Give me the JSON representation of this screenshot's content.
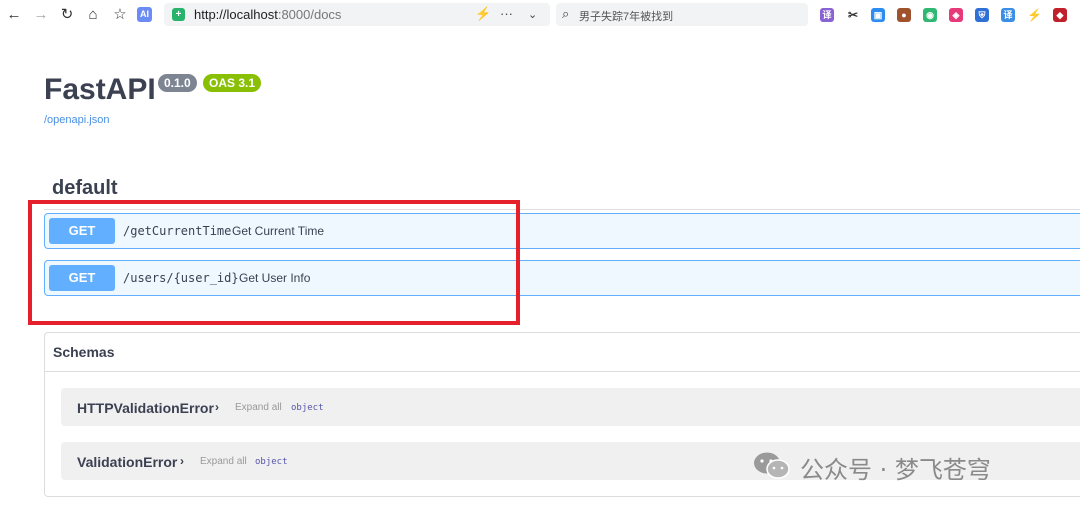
{
  "browser": {
    "url_host": "http://localhost",
    "url_rest": ":8000/docs",
    "search_text": "男子失踪7年被找到",
    "ai_label": "AI",
    "more_label": "···"
  },
  "swagger": {
    "title": "FastAPI",
    "version_badge": "0.1.0",
    "oas_badge": "OAS 3.1",
    "openapi_link": "/openapi.json",
    "section_title": "default",
    "operations": [
      {
        "method": "GET",
        "path": "/getCurrentTime",
        "summary": "Get Current Time"
      },
      {
        "method": "GET",
        "path": "/users/{user_id}",
        "summary": "Get User Info"
      }
    ],
    "schemas_title": "Schemas",
    "schemas": [
      {
        "name": "HTTPValidationError",
        "chevron": "›",
        "expand": "Expand all",
        "type": "object"
      },
      {
        "name": "ValidationError",
        "chevron": "›",
        "expand": "Expand all",
        "type": "object"
      }
    ]
  },
  "watermark": {
    "text": "公众号 · 梦飞苍穹"
  },
  "colors": {
    "get_method": "#61affe",
    "highlight_box": "#e5202a",
    "oas_badge": "#89bf04",
    "version_badge": "#7d8492"
  }
}
